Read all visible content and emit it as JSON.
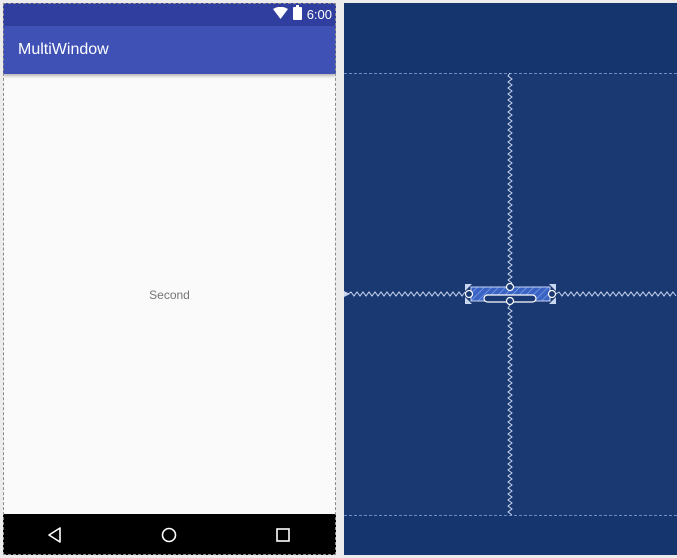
{
  "status_bar": {
    "time": "6:00"
  },
  "app_bar": {
    "title": "MultiWindow"
  },
  "content": {
    "text_view": "Second"
  },
  "colors": {
    "primary_dark": "#303f9f",
    "primary": "#3f51b5",
    "background": "#fafafa",
    "blueprint": "#1a3872",
    "blueprint_line": "#c8d6f0"
  },
  "icons": {
    "status": [
      "wifi-icon",
      "battery-icon"
    ],
    "navigation": [
      "back-icon",
      "home-icon",
      "recents-icon"
    ]
  }
}
